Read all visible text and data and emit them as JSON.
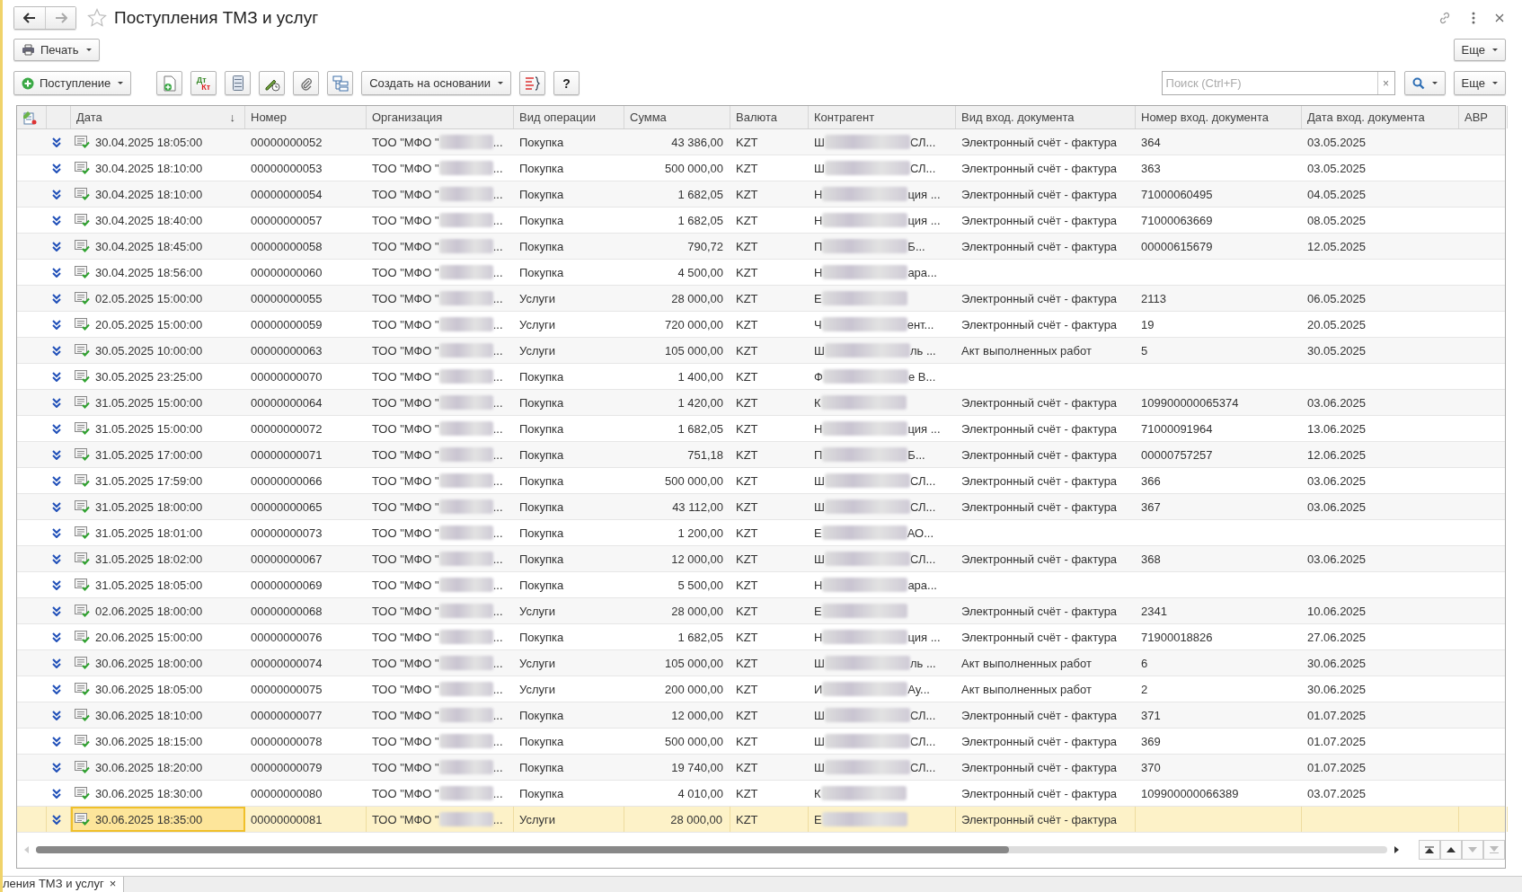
{
  "window": {
    "title": "Поступления ТМЗ и услуг"
  },
  "form_bar": {
    "print": "Печать",
    "more": "Еще"
  },
  "command_bar": {
    "create": "Поступление",
    "dt_kt": [
      "Дт",
      "Кт"
    ],
    "create_based": "Создать на основании",
    "help": "?",
    "search": {
      "placeholder": "Поиск (Ctrl+F)",
      "clear": "×"
    },
    "more": "Еще"
  },
  "table": {
    "columns": [
      {
        "label": "Дата",
        "sort": "↓"
      },
      {
        "label": "Номер"
      },
      {
        "label": "Организация"
      },
      {
        "label": "Вид операции"
      },
      {
        "label": "Сумма"
      },
      {
        "label": "Валюта"
      },
      {
        "label": "Контрагент"
      },
      {
        "label": "Вид вход. документа"
      },
      {
        "label": "Номер вход. документа"
      },
      {
        "label": "Дата вход. документа"
      },
      {
        "label": "АВР"
      }
    ],
    "rows": [
      {
        "selected": false,
        "date": "30.04.2025 18:05:00",
        "number": "00000000052",
        "org": {
          "start": "ТОО \"МФО \"",
          "end": "..."
        },
        "operation": "Покупка",
        "amount": "43 386,00",
        "currency": "KZT",
        "counterparty": {
          "start": "Ш",
          "end": "СЛ..."
        },
        "doc_type": "Электронный счёт - фактура",
        "doc_number": "364",
        "doc_date": "03.05.2025"
      },
      {
        "selected": false,
        "date": "30.04.2025 18:10:00",
        "number": "00000000053",
        "org": {
          "start": "ТОО \"МФО \"",
          "end": "..."
        },
        "operation": "Покупка",
        "amount": "500 000,00",
        "currency": "KZT",
        "counterparty": {
          "start": "Ш",
          "end": "СЛ..."
        },
        "doc_type": "Электронный счёт - фактура",
        "doc_number": "363",
        "doc_date": "03.05.2025"
      },
      {
        "selected": false,
        "date": "30.04.2025 18:10:00",
        "number": "00000000054",
        "org": {
          "start": "ТОО \"МФО \"",
          "end": "..."
        },
        "operation": "Покупка",
        "amount": "1 682,05",
        "currency": "KZT",
        "counterparty": {
          "start": "Н",
          "end": "ция ..."
        },
        "doc_type": "Электронный счёт - фактура",
        "doc_number": "71000060495",
        "doc_date": "04.05.2025"
      },
      {
        "selected": false,
        "date": "30.04.2025 18:40:00",
        "number": "00000000057",
        "org": {
          "start": "ТОО \"МФО \"",
          "end": "..."
        },
        "operation": "Покупка",
        "amount": "1 682,05",
        "currency": "KZT",
        "counterparty": {
          "start": "Н",
          "end": "ция ..."
        },
        "doc_type": "Электронный счёт - фактура",
        "doc_number": "71000063669",
        "doc_date": "08.05.2025"
      },
      {
        "selected": false,
        "date": "30.04.2025 18:45:00",
        "number": "00000000058",
        "org": {
          "start": "ТОО \"МФО \"",
          "end": "..."
        },
        "operation": "Покупка",
        "amount": "790,72",
        "currency": "KZT",
        "counterparty": {
          "start": "П",
          "end": "Б..."
        },
        "doc_type": "Электронный счёт - фактура",
        "doc_number": "00000615679",
        "doc_date": "12.05.2025"
      },
      {
        "selected": false,
        "date": "30.04.2025 18:56:00",
        "number": "00000000060",
        "org": {
          "start": "ТОО \"МФО \"",
          "end": "..."
        },
        "operation": "Покупка",
        "amount": "4 500,00",
        "currency": "KZT",
        "counterparty": {
          "start": "Н",
          "end": "ара..."
        }
      },
      {
        "selected": false,
        "date": "02.05.2025 15:00:00",
        "number": "00000000055",
        "org": {
          "start": "ТОО \"МФО \"",
          "end": "..."
        },
        "operation": "Услуги",
        "amount": "28 000,00",
        "currency": "KZT",
        "counterparty": {
          "start": "Е"
        },
        "doc_type": "Электронный счёт - фактура",
        "doc_number": "2113",
        "doc_date": "06.05.2025"
      },
      {
        "selected": false,
        "date": "20.05.2025 15:00:00",
        "number": "00000000059",
        "org": {
          "start": "ТОО \"МФО \"",
          "end": "..."
        },
        "operation": "Услуги",
        "amount": "720 000,00",
        "currency": "KZT",
        "counterparty": {
          "start": "Ч",
          "end": "ент..."
        },
        "doc_type": "Электронный счёт - фактура",
        "doc_number": "19",
        "doc_date": "20.05.2025"
      },
      {
        "selected": false,
        "date": "30.05.2025 10:00:00",
        "number": "00000000063",
        "org": {
          "start": "ТОО \"МФО \"",
          "end": "..."
        },
        "operation": "Услуги",
        "amount": "105 000,00",
        "currency": "KZT",
        "counterparty": {
          "start": "Ш",
          "end": "ль ..."
        },
        "doc_type": "Акт выполненных работ",
        "doc_number": "5",
        "doc_date": "30.05.2025"
      },
      {
        "selected": false,
        "date": "30.05.2025 23:25:00",
        "number": "00000000070",
        "org": {
          "start": "ТОО \"МФО \"",
          "end": "..."
        },
        "operation": "Покупка",
        "amount": "1 400,00",
        "currency": "KZT",
        "counterparty": {
          "start": "Ф",
          "end": "е В..."
        }
      },
      {
        "selected": false,
        "date": "31.05.2025 15:00:00",
        "number": "00000000064",
        "org": {
          "start": "ТОО \"МФО \"",
          "end": "..."
        },
        "operation": "Покупка",
        "amount": "1 420,00",
        "currency": "KZT",
        "counterparty": {
          "start": "К"
        },
        "doc_type": "Электронный счёт - фактура",
        "doc_number": "109900000065374",
        "doc_date": "03.06.2025"
      },
      {
        "selected": false,
        "date": "31.05.2025 15:00:00",
        "number": "00000000072",
        "org": {
          "start": "ТОО \"МФО \"",
          "end": "..."
        },
        "operation": "Покупка",
        "amount": "1 682,05",
        "currency": "KZT",
        "counterparty": {
          "start": "Н",
          "end": "ция ..."
        },
        "doc_type": "Электронный счёт - фактура",
        "doc_number": "71000091964",
        "doc_date": "13.06.2025"
      },
      {
        "selected": false,
        "date": "31.05.2025 17:00:00",
        "number": "00000000071",
        "org": {
          "start": "ТОО \"МФО \"",
          "end": "..."
        },
        "operation": "Покупка",
        "amount": "751,18",
        "currency": "KZT",
        "counterparty": {
          "start": "П",
          "end": "Б..."
        },
        "doc_type": "Электронный счёт - фактура",
        "doc_number": "00000757257",
        "doc_date": "12.06.2025"
      },
      {
        "selected": false,
        "date": "31.05.2025 17:59:00",
        "number": "00000000066",
        "org": {
          "start": "ТОО \"МФО \"",
          "end": "..."
        },
        "operation": "Покупка",
        "amount": "500 000,00",
        "currency": "KZT",
        "counterparty": {
          "start": "Ш",
          "end": "СЛ..."
        },
        "doc_type": "Электронный счёт - фактура",
        "doc_number": "366",
        "doc_date": "03.06.2025"
      },
      {
        "selected": false,
        "date": "31.05.2025 18:00:00",
        "number": "00000000065",
        "org": {
          "start": "ТОО \"МФО \"",
          "end": "..."
        },
        "operation": "Покупка",
        "amount": "43 112,00",
        "currency": "KZT",
        "counterparty": {
          "start": "Ш",
          "end": "СЛ..."
        },
        "doc_type": "Электронный счёт - фактура",
        "doc_number": "367",
        "doc_date": "03.06.2025"
      },
      {
        "selected": false,
        "date": "31.05.2025 18:01:00",
        "number": "00000000073",
        "org": {
          "start": "ТОО \"МФО \"",
          "end": "..."
        },
        "operation": "Покупка",
        "amount": "1 200,00",
        "currency": "KZT",
        "counterparty": {
          "start": "Е",
          "end": "АО..."
        }
      },
      {
        "selected": false,
        "date": "31.05.2025 18:02:00",
        "number": "00000000067",
        "org": {
          "start": "ТОО \"МФО \"",
          "end": "..."
        },
        "operation": "Покупка",
        "amount": "12 000,00",
        "currency": "KZT",
        "counterparty": {
          "start": "Ш",
          "end": "СЛ..."
        },
        "doc_type": "Электронный счёт - фактура",
        "doc_number": "368",
        "doc_date": "03.06.2025"
      },
      {
        "selected": false,
        "date": "31.05.2025 18:05:00",
        "number": "00000000069",
        "org": {
          "start": "ТОО \"МФО \"",
          "end": "..."
        },
        "operation": "Покупка",
        "amount": "5 500,00",
        "currency": "KZT",
        "counterparty": {
          "start": "Н",
          "end": "ара..."
        }
      },
      {
        "selected": false,
        "date": "02.06.2025 18:00:00",
        "number": "00000000068",
        "org": {
          "start": "ТОО \"МФО \"",
          "end": "..."
        },
        "operation": "Услуги",
        "amount": "28 000,00",
        "currency": "KZT",
        "counterparty": {
          "start": "Е"
        },
        "doc_type": "Электронный счёт - фактура",
        "doc_number": "2341",
        "doc_date": "10.06.2025"
      },
      {
        "selected": false,
        "date": "20.06.2025 15:00:00",
        "number": "00000000076",
        "org": {
          "start": "ТОО \"МФО \"",
          "end": "..."
        },
        "operation": "Покупка",
        "amount": "1 682,05",
        "currency": "KZT",
        "counterparty": {
          "start": "Н",
          "end": "ция ..."
        },
        "doc_type": "Электронный счёт - фактура",
        "doc_number": "71900018826",
        "doc_date": "27.06.2025"
      },
      {
        "selected": false,
        "date": "30.06.2025 18:00:00",
        "number": "00000000074",
        "org": {
          "start": "ТОО \"МФО \"",
          "end": "..."
        },
        "operation": "Услуги",
        "amount": "105 000,00",
        "currency": "KZT",
        "counterparty": {
          "start": "Ш",
          "end": "ль ..."
        },
        "doc_type": "Акт выполненных работ",
        "doc_number": "6",
        "doc_date": "30.06.2025"
      },
      {
        "selected": false,
        "date": "30.06.2025 18:05:00",
        "number": "00000000075",
        "org": {
          "start": "ТОО \"МФО \"",
          "end": "..."
        },
        "operation": "Услуги",
        "amount": "200 000,00",
        "currency": "KZT",
        "counterparty": {
          "start": "И",
          "end": "Ау..."
        },
        "doc_type": "Акт выполненных работ",
        "doc_number": "2",
        "doc_date": "30.06.2025"
      },
      {
        "selected": false,
        "date": "30.06.2025 18:10:00",
        "number": "00000000077",
        "org": {
          "start": "ТОО \"МФО \"",
          "end": "..."
        },
        "operation": "Покупка",
        "amount": "12 000,00",
        "currency": "KZT",
        "counterparty": {
          "start": "Ш",
          "end": "СЛ..."
        },
        "doc_type": "Электронный счёт - фактура",
        "doc_number": "371",
        "doc_date": "01.07.2025"
      },
      {
        "selected": false,
        "date": "30.06.2025 18:15:00",
        "number": "00000000078",
        "org": {
          "start": "ТОО \"МФО \"",
          "end": "..."
        },
        "operation": "Покупка",
        "amount": "500 000,00",
        "currency": "KZT",
        "counterparty": {
          "start": "Ш",
          "end": "СЛ..."
        },
        "doc_type": "Электронный счёт - фактура",
        "doc_number": "369",
        "doc_date": "01.07.2025"
      },
      {
        "selected": false,
        "date": "30.06.2025 18:20:00",
        "number": "00000000079",
        "org": {
          "start": "ТОО \"МФО \"",
          "end": "..."
        },
        "operation": "Покупка",
        "amount": "19 740,00",
        "currency": "KZT",
        "counterparty": {
          "start": "Ш",
          "end": "СЛ..."
        },
        "doc_type": "Электронный счёт - фактура",
        "doc_number": "370",
        "doc_date": "01.07.2025"
      },
      {
        "selected": false,
        "date": "30.06.2025 18:30:00",
        "number": "00000000080",
        "org": {
          "start": "ТОО \"МФО \"",
          "end": "..."
        },
        "operation": "Покупка",
        "amount": "4 010,00",
        "currency": "KZT",
        "counterparty": {
          "start": "К"
        },
        "doc_type": "Электронный счёт - фактура",
        "doc_number": "109900000066389",
        "doc_date": "03.07.2025"
      },
      {
        "selected": true,
        "date": "30.06.2025 18:35:00",
        "number": "00000000081",
        "org": {
          "start": "ТОО \"МФО \"",
          "end": "..."
        },
        "operation": "Услуги",
        "amount": "28 000,00",
        "currency": "KZT",
        "counterparty": {
          "start": "Е"
        },
        "doc_type": "Электронный счёт - фактура"
      }
    ]
  },
  "open_tabs": [
    {
      "label": "ления ТМЗ и услуг",
      "close": "×"
    }
  ]
}
